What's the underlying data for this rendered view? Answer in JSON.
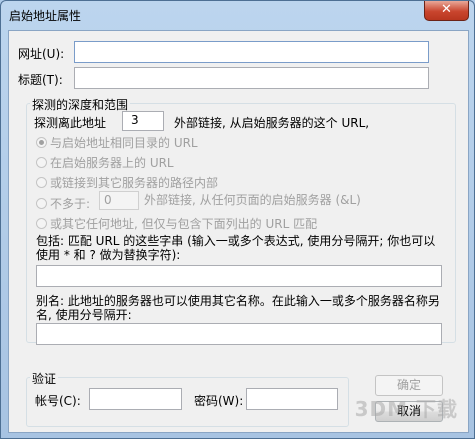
{
  "window": {
    "title": "启始地址属性",
    "close_glyph": "✕"
  },
  "form": {
    "url_label": "网址(U):",
    "url_value": "",
    "title_label": "标题(T):",
    "title_value": ""
  },
  "depth_group": {
    "legend": "探测的深度和范围",
    "depth_prefix": "探测离此地址",
    "depth_value": "3",
    "depth_suffix": "外部链接, 从启始服务器的这个 URL,",
    "options": [
      {
        "label": "与启始地址相同目录的 URL",
        "checked": true
      },
      {
        "label": "在启始服务器上的 URL",
        "checked": false
      },
      {
        "label": "或链接到其它服务器的路径内部",
        "checked": false
      },
      {
        "label": "不多于:",
        "checked": false
      },
      {
        "label": "或其它任何地址, 但仅与包含下面列出的 URL 匹配",
        "checked": false
      }
    ],
    "hops_value": "0",
    "hops_suffix": "外部链接, 从任何页面的启始服务器 (&L)",
    "include_text": "包括: 匹配 URL 的这些字串 (输入一或多个表达式, 使用分号隔开; 你也可以使用 * 和 ? 做为替换字符):",
    "include_value": "",
    "alias_text": "别名: 此地址的服务器也可以使用其它名称。在此输入一或多个服务器名称另名, 使用分号隔开:",
    "alias_value": ""
  },
  "auth_group": {
    "legend": "验证",
    "account_label": "帐号(C):",
    "account_value": "",
    "password_label": "密码(W):",
    "password_value": ""
  },
  "buttons": {
    "ok": "确定",
    "cancel": "取消"
  },
  "watermark": "3DM 下载"
}
